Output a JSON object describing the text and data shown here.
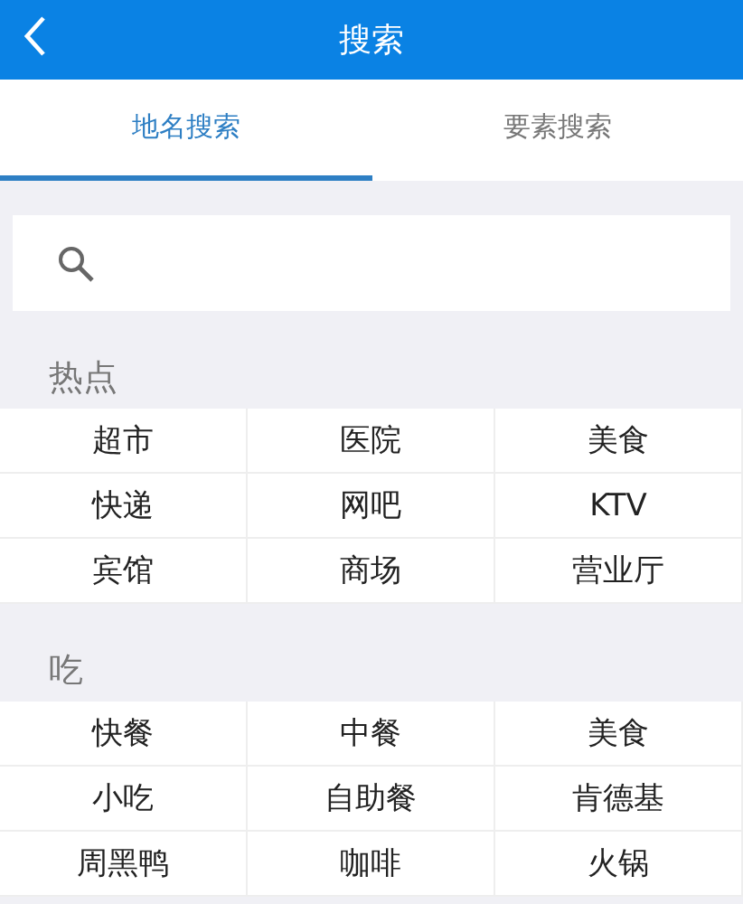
{
  "header": {
    "title": "搜索"
  },
  "tabs": [
    {
      "label": "地名搜索",
      "selected": true
    },
    {
      "label": "要素搜索",
      "selected": false
    }
  ],
  "sections": [
    {
      "title": "热点",
      "items": [
        "超市",
        "医院",
        "美食",
        "快递",
        "网吧",
        "KTV",
        "宾馆",
        "商场",
        "营业厅"
      ]
    },
    {
      "title": "吃",
      "items": [
        "快餐",
        "中餐",
        "美食",
        "小吃",
        "自助餐",
        "肯德基",
        "周黑鸭",
        "咖啡",
        "火锅"
      ]
    }
  ]
}
